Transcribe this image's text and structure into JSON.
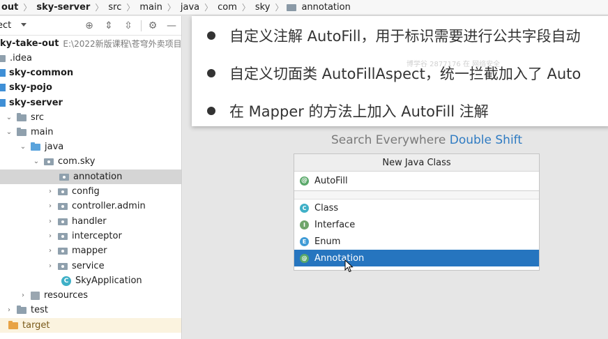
{
  "breadcrumb": {
    "items": [
      {
        "label": "out",
        "bold": true
      },
      {
        "label": "sky-server",
        "bold": true
      },
      {
        "label": "src"
      },
      {
        "label": "main"
      },
      {
        "label": "java"
      },
      {
        "label": "com"
      },
      {
        "label": "sky"
      },
      {
        "label": "annotation"
      }
    ]
  },
  "project": {
    "title": "ect",
    "tree": [
      {
        "label": "ky-take-out",
        "path": "E:\\2022新版课程\\苍穹外卖项目",
        "bold": true
      },
      {
        "label": ".idea"
      },
      {
        "label": "sky-common",
        "bold": true
      },
      {
        "label": "sky-pojo",
        "bold": true
      },
      {
        "label": "sky-server",
        "bold": true
      },
      {
        "label": "src"
      },
      {
        "label": "main"
      },
      {
        "label": "java"
      },
      {
        "label": "com.sky"
      },
      {
        "label": "annotation"
      },
      {
        "label": "config"
      },
      {
        "label": "controller.admin"
      },
      {
        "label": "handler"
      },
      {
        "label": "interceptor"
      },
      {
        "label": "mapper"
      },
      {
        "label": "service"
      },
      {
        "label": "SkyApplication",
        "icon_letter": "C"
      },
      {
        "label": "resources"
      },
      {
        "label": "test"
      },
      {
        "label": "target"
      }
    ]
  },
  "slide": {
    "bullets": [
      "自定义注解 AutoFill，用于标识需要进行公共字段自动",
      "自定义切面类 AutoFillAspect，统一拦截加入了 Auto",
      "在 Mapper 的方法上加入 AutoFill 注解"
    ],
    "watermark": "博学谷 2877176 在 网络安全"
  },
  "search_hint": {
    "text": "Search Everywhere",
    "shortcut": "Double Shift"
  },
  "new_class_popup": {
    "title": "New Java Class",
    "input_value": "AutoFill",
    "input_icon_letter": "@",
    "options": [
      {
        "label": "Class",
        "icon_letter": "C"
      },
      {
        "label": "Interface",
        "icon_letter": "I"
      },
      {
        "label": "Enum",
        "icon_letter": "E"
      },
      {
        "label": "Annotation",
        "icon_letter": "@"
      }
    ],
    "selected_option": "Annotation"
  },
  "colors": {
    "selection": "#2675bf",
    "link": "#2f7bc2",
    "module": "#3f8fd6",
    "target_folder": "#e8a346"
  }
}
